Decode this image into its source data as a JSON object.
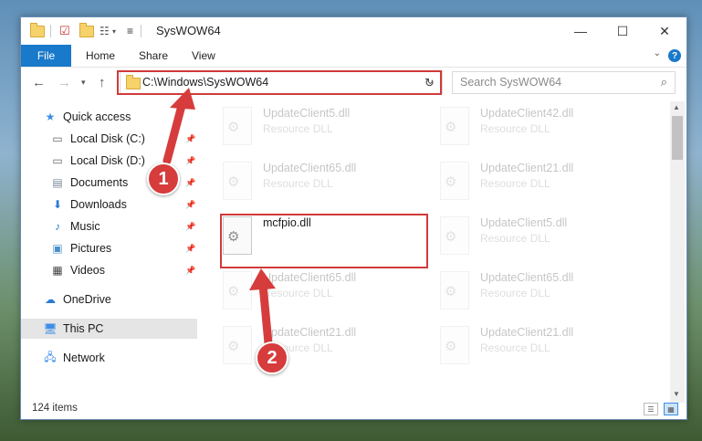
{
  "window": {
    "title": "SysWOW64",
    "controls": {
      "minimize": "—",
      "maximize": "☐",
      "close": "✕"
    }
  },
  "ribbon": {
    "tabs": [
      {
        "label": "File"
      },
      {
        "label": "Home"
      },
      {
        "label": "Share"
      },
      {
        "label": "View"
      }
    ],
    "help_label": "?"
  },
  "nav": {
    "address": "C:\\Windows\\SysWOW64",
    "search_placeholder": "Search SysWOW64"
  },
  "sidebar": {
    "items": [
      {
        "label": "Quick access",
        "icon": "star-icon"
      },
      {
        "label": "Local Disk (C:)",
        "icon": "drive-icon",
        "pinned": true
      },
      {
        "label": "Local Disk (D:)",
        "icon": "drive-icon",
        "pinned": true
      },
      {
        "label": "Documents",
        "icon": "documents-icon",
        "pinned": true
      },
      {
        "label": "Downloads",
        "icon": "download-icon",
        "pinned": true
      },
      {
        "label": "Music",
        "icon": "music-icon",
        "pinned": true
      },
      {
        "label": "Pictures",
        "icon": "pictures-icon",
        "pinned": true
      },
      {
        "label": "Videos",
        "icon": "videos-icon",
        "pinned": true
      },
      {
        "label": "OneDrive",
        "icon": "cloud-icon"
      },
      {
        "label": "This PC",
        "icon": "computer-icon",
        "selected": true
      },
      {
        "label": "Network",
        "icon": "network-icon"
      }
    ]
  },
  "files": {
    "col1": [
      {
        "name": "UpdateClient5.dll",
        "desc": "Resource DLL"
      },
      {
        "name": "UpdateClient65.dll",
        "desc": "Resource DLL"
      },
      {
        "name": "mcfpio.dll",
        "desc": ""
      },
      {
        "name": "UpdateClient65.dll",
        "desc": "Resource DLL"
      },
      {
        "name": "UpdateClient21.dll",
        "desc": "Resource DLL"
      }
    ],
    "col2": [
      {
        "name": "UpdateClient42.dll",
        "desc": "Resource DLL"
      },
      {
        "name": "UpdateClient21.dll",
        "desc": "Resource DLL"
      },
      {
        "name": "UpdateClient5.dll",
        "desc": "Resource DLL"
      },
      {
        "name": "UpdateClient65.dll",
        "desc": "Resource DLL"
      },
      {
        "name": "UpdateClient21.dll",
        "desc": "Resource DLL"
      }
    ]
  },
  "status": {
    "item_count": "124 items"
  },
  "annotations": {
    "step1": "1",
    "step2": "2",
    "color": "#d63c3c"
  }
}
